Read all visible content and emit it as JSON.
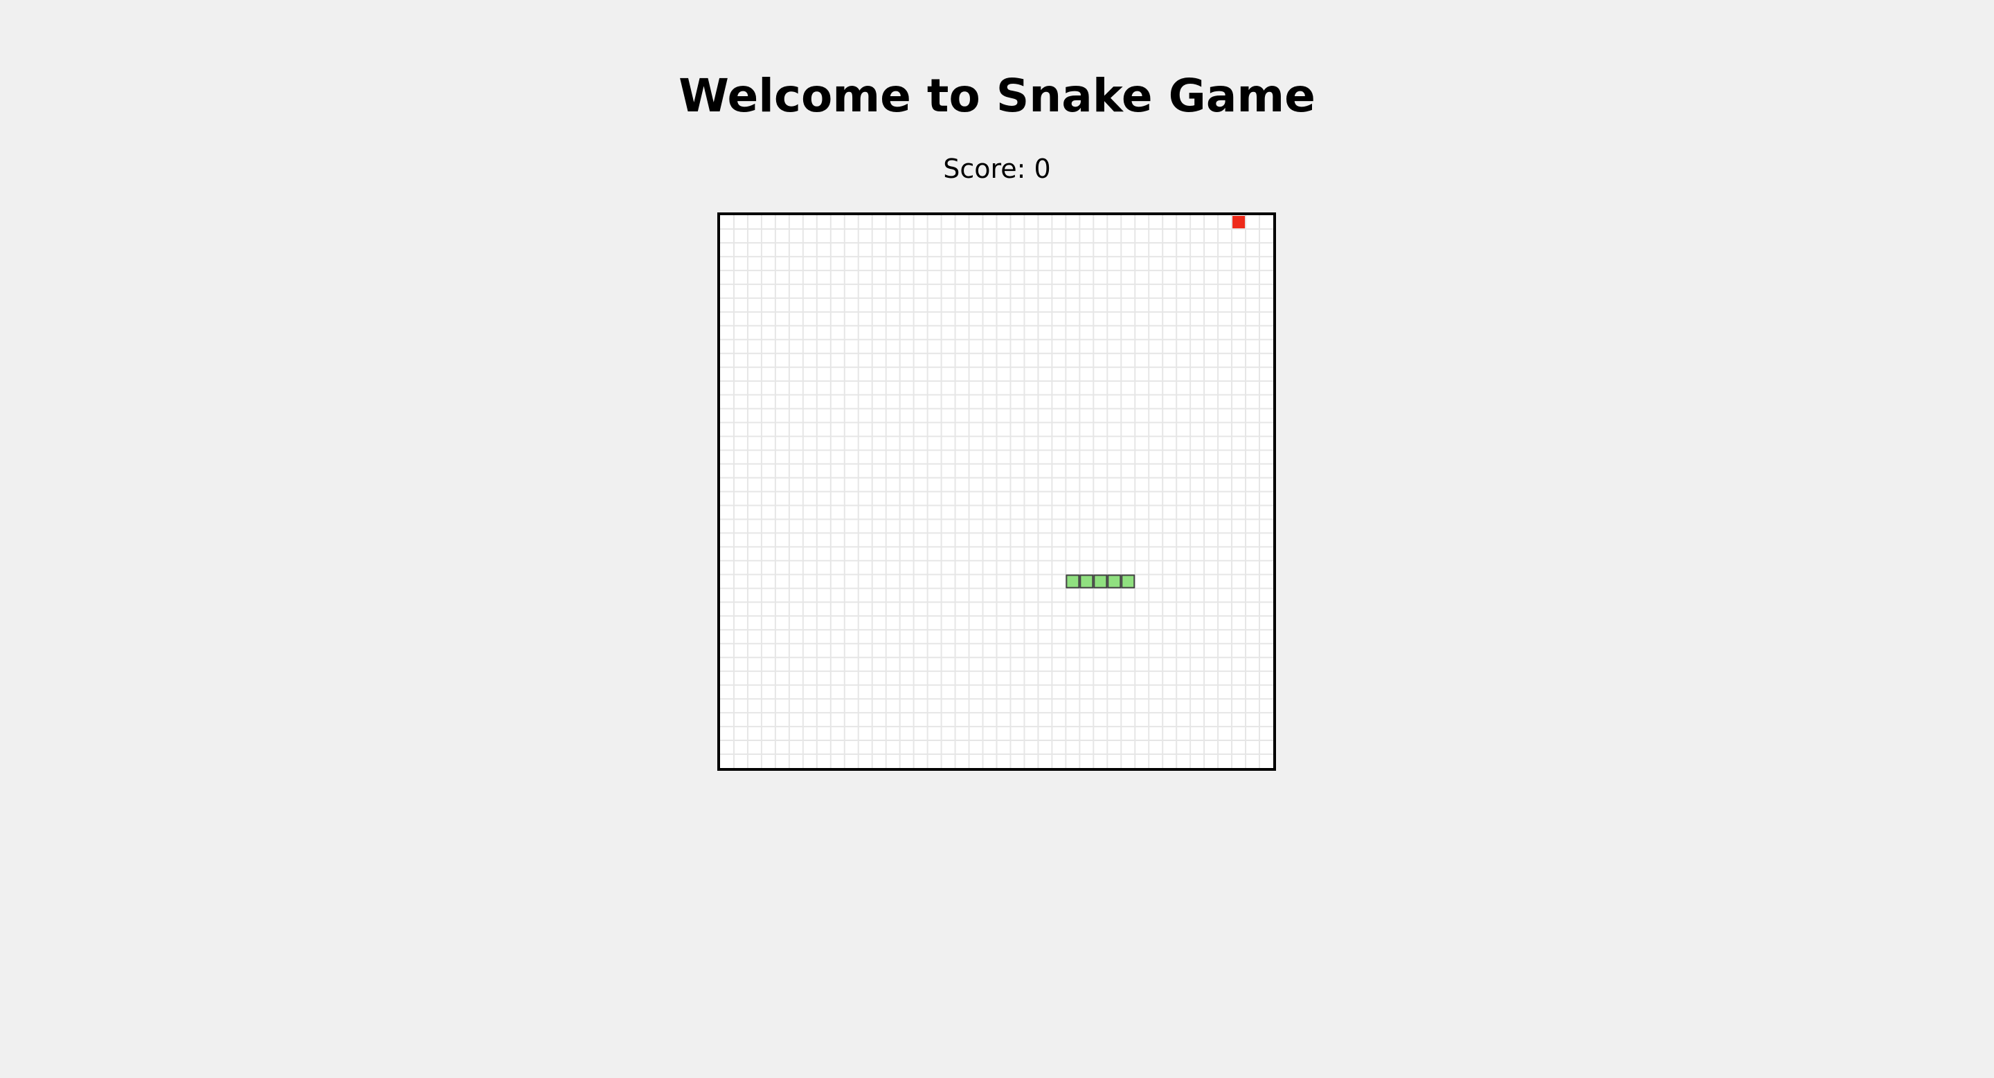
{
  "header": {
    "title": "Welcome to Snake Game"
  },
  "score": {
    "label": "Score: 0",
    "value": 0
  },
  "board": {
    "columns": 40,
    "rows": 40,
    "show_grid": true,
    "colors": {
      "background": "#ffffff",
      "grid_line": "#e6e6e6",
      "border": "#000000",
      "snake_fill": "#90e080",
      "snake_stroke": "#444444",
      "food_fill": "#ee2a1a"
    },
    "snake": [
      {
        "col": 29,
        "row": 26
      },
      {
        "col": 28,
        "row": 26
      },
      {
        "col": 27,
        "row": 26
      },
      {
        "col": 26,
        "row": 26
      },
      {
        "col": 25,
        "row": 26
      }
    ],
    "food": {
      "col": 37,
      "row": 0
    }
  }
}
